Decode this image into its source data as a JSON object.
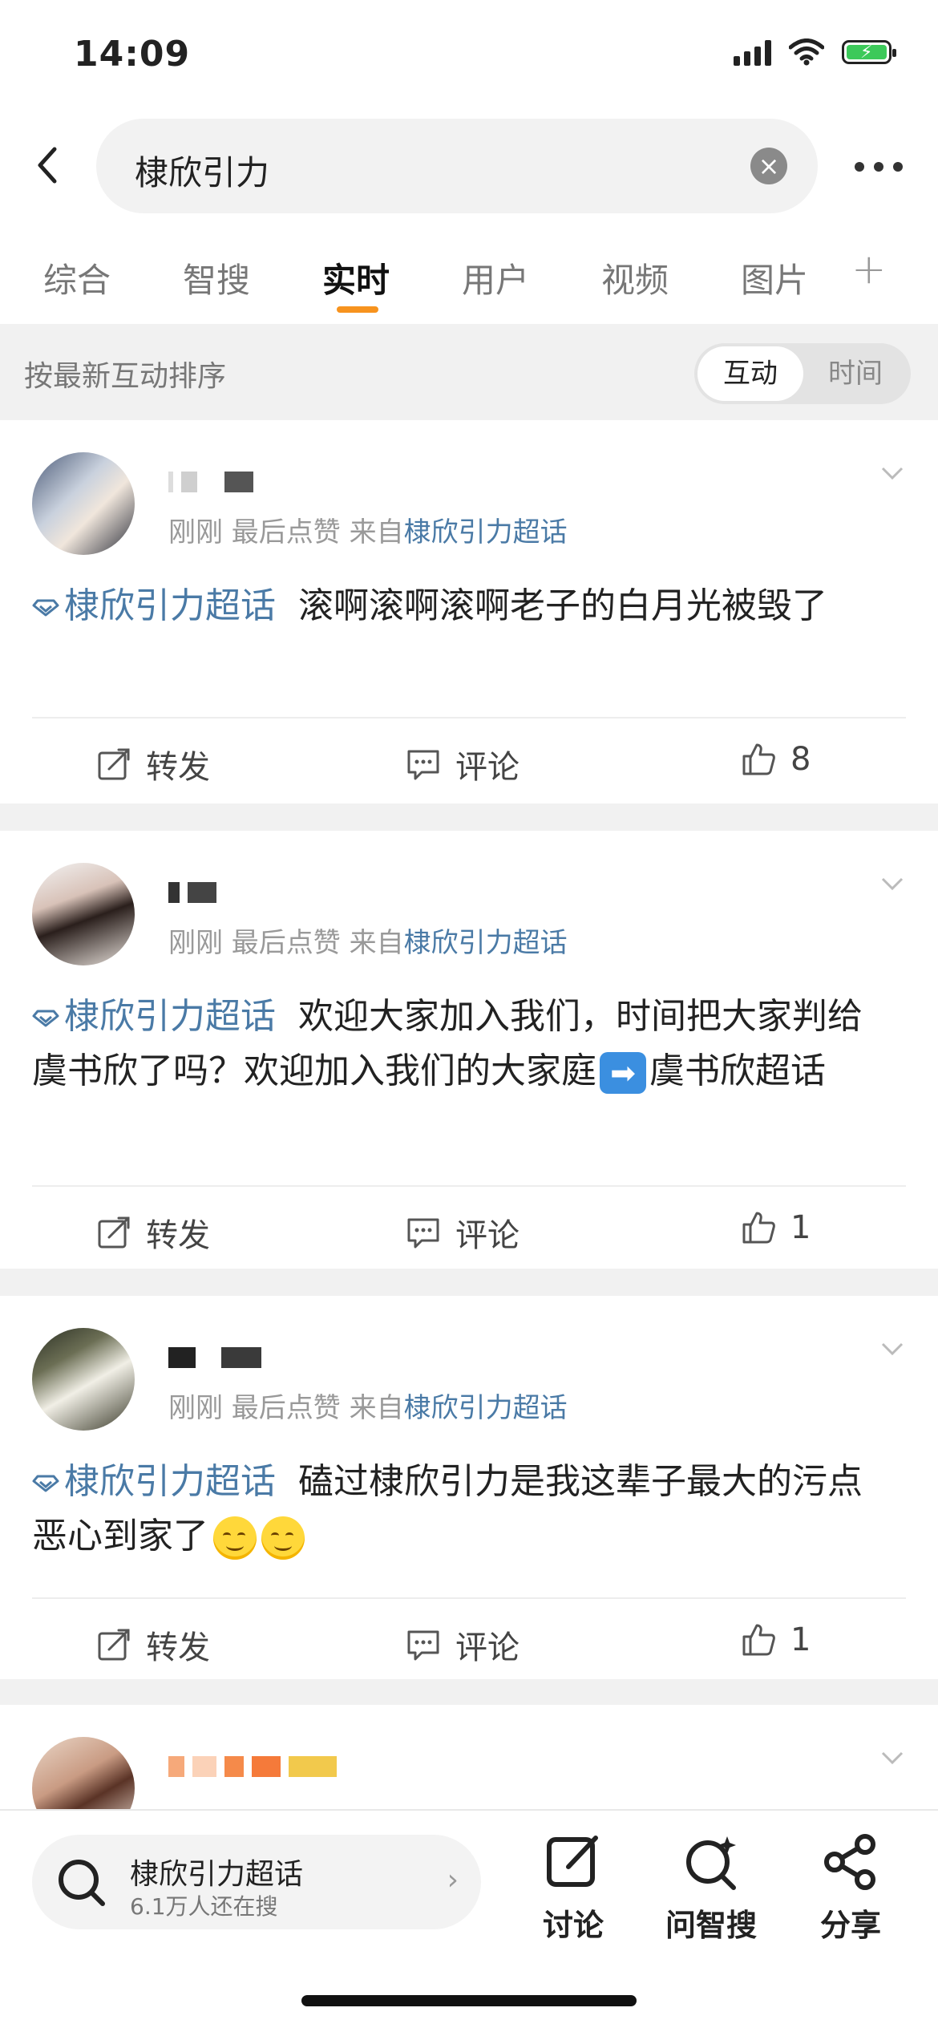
{
  "status": {
    "time": "14:09"
  },
  "search": {
    "query": "棣欣引力"
  },
  "tabs": [
    {
      "label": "综合"
    },
    {
      "label": "智搜"
    },
    {
      "label": "实时"
    },
    {
      "label": "用户"
    },
    {
      "label": "视频"
    },
    {
      "label": "图片"
    }
  ],
  "active_tab": "实时",
  "sort": {
    "label": "按最新互动排序",
    "option_on": "互动",
    "option_off": "时间"
  },
  "posts": [
    {
      "meta_prefix": "刚刚  最后点赞  来自",
      "meta_link": "棣欣引力超话",
      "topic": "棣欣引力超话",
      "text": "滚啊滚啊滚啊老子的白月光被毁了",
      "repost": "转发",
      "comment": "评论",
      "likes": "8"
    },
    {
      "meta_prefix": "刚刚  最后点赞  来自",
      "meta_link": "棣欣引力超话",
      "topic": "棣欣引力超话",
      "text_a": "欢迎大家加入我们，时间把大家判给虞书欣了吗？欢迎加入我们的大家庭",
      "text_b": "虞书欣超话",
      "repost": "转发",
      "comment": "评论",
      "likes": "1"
    },
    {
      "meta_prefix": "刚刚  最后点赞  来自",
      "meta_link": "棣欣引力超话",
      "topic": "棣欣引力超话",
      "text": "磕过棣欣引力是我这辈子最大的污点 恶心到家了",
      "repost": "转发",
      "comment": "评论",
      "likes": "1"
    }
  ],
  "bottom": {
    "hot_title": "棣欣引力超话",
    "hot_sub": "6.1万人还在搜",
    "discuss": "讨论",
    "ask": "问智搜",
    "share": "分享"
  },
  "colors": {
    "accent": "#f7931e",
    "link": "#4a7aa6"
  }
}
